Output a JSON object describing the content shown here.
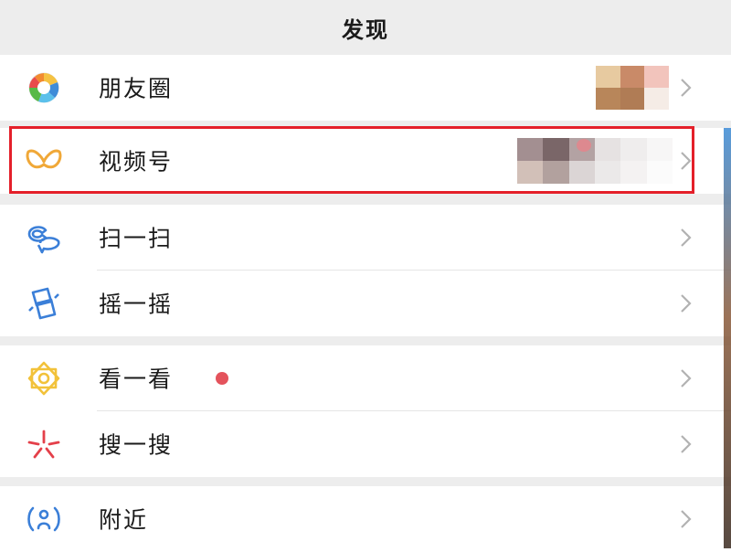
{
  "header": {
    "title": "发现"
  },
  "groups": [
    {
      "items": [
        {
          "label": "朋友圈",
          "icon": "moments-aperture-icon"
        }
      ]
    },
    {
      "items": [
        {
          "label": "视频号",
          "icon": "channels-butterfly-icon"
        }
      ]
    },
    {
      "items": [
        {
          "label": "扫一扫",
          "icon": "scan-icon"
        },
        {
          "label": "摇一摇",
          "icon": "shake-icon"
        }
      ]
    },
    {
      "items": [
        {
          "label": "看一看",
          "icon": "top-stories-icon",
          "badge": "red-dot"
        },
        {
          "label": "搜一搜",
          "icon": "search-spark-icon"
        }
      ]
    },
    {
      "items": [
        {
          "label": "附近",
          "icon": "nearby-icon"
        }
      ]
    }
  ],
  "colors": {
    "background": "#ededed",
    "row": "#ffffff",
    "highlight": "#e4202a",
    "badge": "#e4535c",
    "chevron": "#b2b2b2"
  }
}
